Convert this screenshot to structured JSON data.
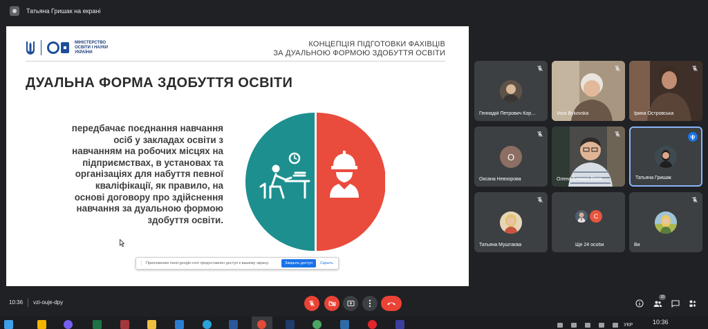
{
  "topbar": {
    "presenter_text": "Татьяна Гришак на екрані"
  },
  "slide": {
    "logo_text": "МІНІСТЕРСТВО ОСВІТИ І НАУКИ УКРАЇНИ",
    "heading_line1": "КОНЦЕПЦІЯ ПІДГОТОВКИ ФАХІВЦІВ",
    "heading_line2": "ЗА ДУАЛЬНОЮ ФОРМОЮ ЗДОБУТТЯ ОСВІТИ",
    "title": "ДУАЛЬНА ФОРМА ЗДОБУТТЯ ОСВІТИ",
    "body": "передбачає поєднання навчання осіб у закладах освіти з навчанням на робочих місцях на підприємствах, в установах та організаціях для набуття певної кваліфікації, як правило, на основі договору про здійснення навчання за дуальною формою здобуття освіти.",
    "left_color": "#1e8f8f",
    "right_color": "#e94b3c"
  },
  "share_bar": {
    "text": "Приложению meet.google.com предоставлен доступ к вашему экрану.",
    "stop_label": "Закрыть доступ",
    "hide_label": "Скрыть"
  },
  "participants": [
    {
      "name": "Геннадій Петрович Кор…",
      "type": "photo",
      "avatar_color": "#7a6a55"
    },
    {
      "name": "Vora Bykovska",
      "type": "video",
      "avatar_color": "#b7a58c"
    },
    {
      "name": "Ірина Островська",
      "type": "video",
      "avatar_color": "#4b3d33"
    },
    {
      "name": "Оксана Невзорова",
      "type": "letter",
      "initial": "О",
      "avatar_color": "#8d6e63"
    },
    {
      "name": "Олена Блажко-Воєв…",
      "type": "video",
      "avatar_color": "#505050"
    },
    {
      "name": "Татьяна Гришак",
      "type": "photo",
      "avatar_color": "#2f3a3f"
    },
    {
      "name": "Татьяна Муштаєва",
      "type": "photo",
      "avatar_color": "#c9a06e"
    },
    {
      "name": "Ще 24 особи",
      "type": "more",
      "initial": "С",
      "avatar_color": "#e8553e"
    },
    {
      "name": "Ви",
      "type": "photo",
      "avatar_color": "#b8c86a"
    }
  ],
  "controls": {
    "time": "10:36",
    "code": "vzi-ouje-dpy",
    "people_count": "33",
    "mic_icon": "mic-off-icon",
    "cam_icon": "camera-off-icon",
    "present_icon": "present-icon",
    "more_icon": "more-vert-icon",
    "hangup_icon": "hangup-icon"
  },
  "taskbar": {
    "lang": "УКР",
    "clock": "10:36"
  }
}
